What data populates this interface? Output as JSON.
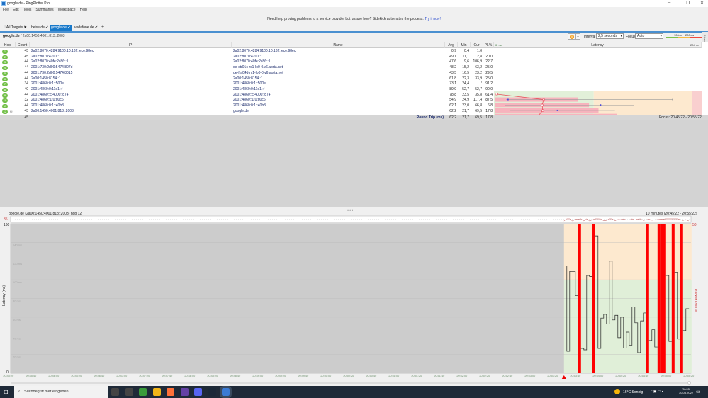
{
  "window": {
    "title": "google.de - PingPlotter Pro",
    "controls": [
      "─",
      "❐",
      "✕"
    ]
  },
  "menu": [
    "File",
    "Edit",
    "Tools",
    "Summaries",
    "Workspace",
    "Help"
  ],
  "banner": {
    "text": "Need help proving problems to a service provider but unsure how? Sidekick automates the process. ",
    "link": "Try it now!"
  },
  "tabs": [
    {
      "label": "All Targets",
      "mark": "✖",
      "active": false
    },
    {
      "label": "heise.de",
      "mark": "✔",
      "active": false
    },
    {
      "label": "google.de",
      "mark": "✔",
      "active": true
    },
    {
      "label": "vodafone.de",
      "mark": "✔",
      "active": false
    }
  ],
  "add_tab": "+",
  "breadcrumb": {
    "target": "google.de",
    "path": " / 2a00:1450:4001:813::2003"
  },
  "toolbar": {
    "pause_icon": "pause-icon",
    "interval_label": "Interval",
    "interval_value": "2,5 seconds",
    "focus_label": "Focus",
    "focus_value": "Auto",
    "scale_100": "100ms",
    "scale_200": "200ms",
    "colors": {
      "good": "#7cc04a",
      "warn": "#f5b942",
      "bad": "#f04b3c"
    }
  },
  "alerts_tab": "Alerts",
  "table": {
    "columns": [
      "Hop",
      "Count",
      "IP",
      "Name",
      "Avg",
      "Min",
      "Cur",
      "PL%",
      "Latency"
    ],
    "latency_min_label": "0 ms",
    "latency_max_label": "204 ms",
    "rows": [
      {
        "hop": "1",
        "count": "45",
        "ip": "2a02:8070:4284:9100:10:18ff:fece:98ec",
        "name": "2a02:8070:4284:9100:10:18ff:fece:98ec",
        "avg": "0,9",
        "min": "0,4",
        "cur": "1,0",
        "pl": ""
      },
      {
        "hop": "2",
        "count": "45",
        "ip": "2a02:8070:4200::1",
        "name": "2a02:8070:4200::1",
        "avg": "49,1",
        "min": "11,1",
        "cur": "12,8",
        "pl": "20,0"
      },
      {
        "hop": "3",
        "count": "44",
        "ip": "2a02:8070:40fe:2c86::1",
        "name": "2a02:8070:40fe:2c86::1",
        "avg": "47,6",
        "min": "9,6",
        "cur": "106,9",
        "pl": "22,7"
      },
      {
        "hop": "4",
        "count": "44",
        "ip": "2001:730:2d00:5474:807d",
        "name": "de-str01c-rc1-lo0-0.v6.aorta.net",
        "avg": "48,2",
        "min": "15,2",
        "cur": "63,2",
        "pl": "25,0"
      },
      {
        "hop": "5",
        "count": "44",
        "ip": "2001:730:2d00:5474:8015",
        "name": "de-fra04d-rc1-lo0-0.v6.aorta.net",
        "avg": "43,5",
        "min": "16,5",
        "cur": "23,2",
        "pl": "29,5"
      },
      {
        "hop": "6",
        "count": "44",
        "ip": "2a00:1450:8154::1",
        "name": "2a00:1450:8154::1",
        "avg": "61,8",
        "min": "22,3",
        "cur": "33,9",
        "pl": "25,0"
      },
      {
        "hop": "7",
        "count": "34",
        "ip": "2001:4860:0:1::500e",
        "name": "2001:4860:0:1::500e",
        "avg": "73,1",
        "min": "24,4",
        "cur": "*",
        "pl": "91,2"
      },
      {
        "hop": "8",
        "count": "40",
        "ip": "2001:4860:0:11e1::f",
        "name": "2001:4860:0:11e1::f",
        "avg": "89,9",
        "min": "52,7",
        "cur": "52,7",
        "pl": "90,0"
      },
      {
        "hop": "9",
        "count": "44",
        "ip": "2001:4860::c:4000:f874",
        "name": "2001:4860::c:4000:f874",
        "avg": "78,8",
        "min": "23,5",
        "cur": "35,8",
        "pl": "61,4"
      },
      {
        "hop": "10",
        "count": "32",
        "ip": "2001:4860::1:0:d0c6",
        "name": "2001:4860::1:0:d0c6",
        "avg": "54,9",
        "min": "24,9",
        "cur": "117,4",
        "pl": "87,5"
      },
      {
        "hop": "11",
        "count": "44",
        "ip": "2001:4860:0:1::40b3",
        "name": "2001:4860:0:1::40b3",
        "avg": "62,1",
        "min": "23,0",
        "cur": "66,8",
        "pl": "6,8"
      },
      {
        "hop": "12",
        "count": "45",
        "ip": "2a00:1450:4001:813::2003",
        "name": "google.de",
        "avg": "62,2",
        "min": "21,7",
        "cur": "69,5",
        "pl": "17,8",
        "icon": "database-icon"
      }
    ],
    "summary": {
      "count": "45",
      "label": "Round Trip (ms)",
      "avg": "62,2",
      "min": "21,7",
      "cur": "69,5",
      "pl": "17,8",
      "focus": "Focus: 20:45:22 - 20:55:22"
    }
  },
  "chart_data": [
    {
      "type": "table-latency-graph",
      "xlim_ms": [
        0,
        204
      ],
      "pl_scale_percent": [
        0,
        50
      ],
      "zones_ms": {
        "good": [
          0,
          100
        ],
        "warn": [
          100,
          200
        ],
        "bad": [
          200,
          204
        ]
      },
      "hops": [
        {
          "avg": 0.9,
          "min": 0.4,
          "max": null,
          "cur": 1.0,
          "pl": 0
        },
        {
          "avg": 49.1,
          "min": 11.1,
          "max": 180,
          "cur": 12.8,
          "pl": 20.0
        },
        {
          "avg": 47.6,
          "min": 9.6,
          "max": 141,
          "cur": 106.9,
          "pl": 22.7
        },
        {
          "avg": 48.2,
          "min": 15.2,
          "max": 121,
          "cur": 63.2,
          "pl": 25.0
        },
        {
          "avg": 43.5,
          "min": 16.5,
          "max": 189,
          "cur": 23.2,
          "pl": 29.5
        },
        {
          "avg": 61.8,
          "min": 22.3,
          "max": 147,
          "cur": 33.9,
          "pl": 25.0
        },
        {
          "avg": 73.1,
          "min": 24.4,
          "max": 98,
          "cur": null,
          "pl": 91.2
        },
        {
          "avg": 89.9,
          "min": 52.7,
          "max": 193,
          "cur": 52.7,
          "pl": 90.0
        },
        {
          "avg": 78.8,
          "min": 23.5,
          "max": 204,
          "cur": 35.8,
          "pl": 61.4
        },
        {
          "avg": 54.9,
          "min": 24.9,
          "max": 204,
          "cur": 117.4,
          "pl": 87.5
        },
        {
          "avg": 62.1,
          "min": 23.0,
          "max": 151,
          "cur": 66.8,
          "pl": 6.8
        },
        {
          "avg": 62.2,
          "min": 21.7,
          "max": 148,
          "cur": 69.5,
          "pl": 17.8
        }
      ],
      "colors": {
        "avg": "#e8505b",
        "cur": "#4b4bdc",
        "pl": "#f7b3bd",
        "good": "#e2f0d9",
        "warn": "#fde9cf",
        "bad": "#f9cfcf"
      }
    },
    {
      "type": "line",
      "title": "google.de (2a00:1450:4001:813::2003) hop 12",
      "range_label": "10 minutes (20:45:22 - 20:55:22)",
      "ylabel": "Latency (ms)",
      "y2label": "Packet Loss %",
      "ylim": [
        0,
        160
      ],
      "y2_top_label": "50",
      "y_top_label": "160",
      "y_bottom_label": "0",
      "y_grid_labels": [
        "140 ms",
        "120 ms",
        "100 ms",
        "80 ms",
        "60 ms",
        "40 ms",
        "20 ms"
      ],
      "jitter_label": "Jitter (ms)",
      "jitter_top_label": "35",
      "x_start": "20:45:22",
      "x_end": "20:55:22",
      "first_sample": "20:53:30",
      "sample_interval_s": 2.5,
      "x_tick_labels": [
        "20:45:20",
        "20:45:40",
        "20:46:00",
        "20:46:20",
        "20:46:40",
        "20:47:00",
        "20:47:20",
        "20:47:40",
        "20:48:00",
        "20:48:20",
        "20:48:40",
        "20:49:00",
        "20:49:20",
        "20:49:40",
        "20:50:00",
        "20:50:20",
        "20:50:40",
        "20:51:00",
        "20:51:20",
        "20:51:40",
        "20:52:00",
        "20:52:20",
        "20:52:40",
        "20:53:00",
        "20:53:20",
        "20:53:40",
        "20:54:00",
        "20:54:20",
        "20:54:40",
        "20:55:00",
        "20:55:20"
      ],
      "latency_ms": [
        115,
        23.5,
        109,
        109,
        83,
        null,
        26.5,
        25,
        104.6,
        103.5,
        null,
        147,
        26.5,
        59,
        63,
        52.6,
        120,
        57,
        62,
        38,
        60,
        27,
        44,
        30,
        71,
        54,
        22,
        56,
        64.5,
        null,
        35,
        46.5,
        28,
        null,
        null,
        null,
        104.6,
        34,
        null,
        108,
        36.6,
        null,
        45.6,
        69,
        68.5
      ],
      "lost_marker": "null = packet lost (red bar)",
      "colors": {
        "loss": "#ff0000",
        "warn_zone": "#fde9cf",
        "good_zone": "#e0efd8",
        "no_data": "#cccccc"
      },
      "warn_threshold_ms": 100
    }
  ],
  "taskbar": {
    "search_placeholder": "Suchbegriff hier eingeben",
    "weather": "16°C Sonnig",
    "time": "20:55",
    "date": "30.05.2022",
    "apps": [
      "cortana-icon",
      "task-view-icon",
      "xbox-icon",
      "file-explorer-icon",
      "firefox-icon",
      "twitch-icon",
      "discord-icon",
      "steam-icon",
      "pingplotter-icon"
    ]
  }
}
